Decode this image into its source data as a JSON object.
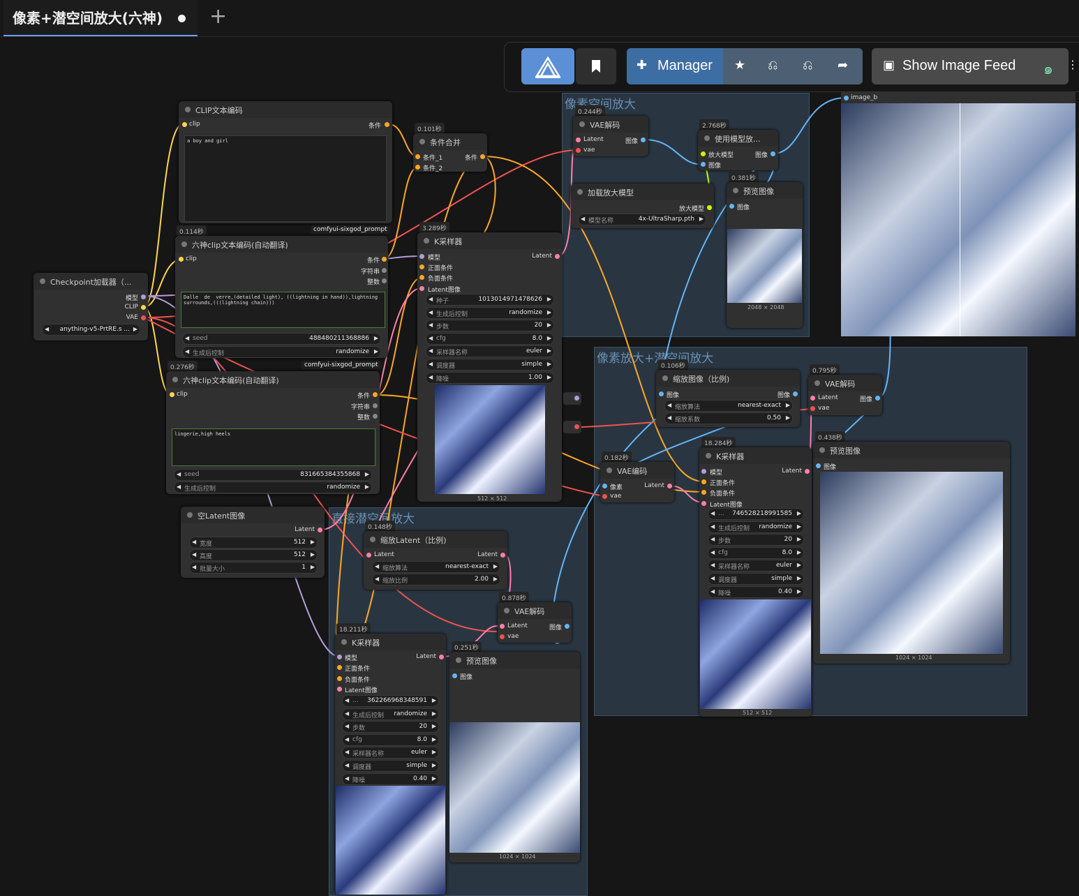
{
  "tab": {
    "title": "像素+潜空间放大(六神)"
  },
  "toolbar": {
    "manager_label": "Manager",
    "feed_label": "Show Image Feed"
  },
  "groups": {
    "pixel": "像素空间放大",
    "mixed": "像素放大+潜空间放大",
    "direct": "直接潜空间放大"
  },
  "nodes": {
    "clip_encode": {
      "title": "CLIP文本编码",
      "in_clip": "clip",
      "out": "条件",
      "text": "a boy and girl"
    },
    "cond_combine": {
      "timing": "0.101秒",
      "title": "条件合并",
      "in1": "条件_1",
      "in2": "条件_2",
      "out": "条件"
    },
    "six_pos": {
      "timing": "0.114秒",
      "tag": "comfyui-sixgod_prompt",
      "title": "六神clip文本编码(自动翻译)",
      "in_clip": "clip",
      "out1": "条件",
      "out2": "字符串",
      "out3": "整数",
      "text": "Dalle  de  verre,(detailed light), ((lightning in hand)),lightning surrounds,(((lightning chain)))",
      "seed_label": "seed",
      "seed": "488480211368886",
      "ctrl_label": "生成后控制",
      "ctrl": "randomize"
    },
    "six_neg": {
      "timing": "0.276秒",
      "tag": "comfyui-sixgod_prompt",
      "title": "六神clip文本编码(自动翻译)",
      "in_clip": "clip",
      "out1": "条件",
      "out2": "字符串",
      "out3": "整数",
      "text": "lingerie,high heels",
      "seed_label": "seed",
      "seed": "831665384355868",
      "ctrl_label": "生成后控制",
      "ctrl": "randomize"
    },
    "checkpoint": {
      "title": "Checkpoint加载器（...",
      "out1": "模型",
      "out2": "CLIP",
      "out3": "VAE",
      "model": "anything-v5-PrtRE.s ..."
    },
    "empty_latent": {
      "title": "空Latent图像",
      "out": "Latent",
      "w_label": "宽度",
      "w": "512",
      "h_label": "高度",
      "h": "512",
      "b_label": "批量大小",
      "b": "1"
    },
    "ksampler1": {
      "timing": "3.289秒",
      "title": "K采样器",
      "in1": "模型",
      "in2": "正面条件",
      "in3": "负面条件",
      "in4": "Latent图像",
      "out": "Latent",
      "rows": [
        {
          "l": "种子",
          "v": "1013014971478626"
        },
        {
          "l": "生成后控制",
          "v": "randomize"
        },
        {
          "l": "步数",
          "v": "20"
        },
        {
          "l": "cfg",
          "v": "8.0"
        },
        {
          "l": "采样器名称",
          "v": "euler"
        },
        {
          "l": "调度器",
          "v": "simple"
        },
        {
          "l": "降噪",
          "v": "1.00"
        }
      ],
      "dims": "512 × 512"
    },
    "vae_decode1": {
      "timing": "0.244秒",
      "title": "VAE解码",
      "in1": "Latent",
      "in2": "vae",
      "out": "图像"
    },
    "upscale_use": {
      "timing": "2.768秒",
      "title": "使用模型放...",
      "in1": "放大模型",
      "in2": "图像",
      "out": "图像"
    },
    "load_upscale": {
      "title": "加载放大模型",
      "out": "放大模型",
      "w_label": "模型名称",
      "w": "4x-UltraSharp.pth"
    },
    "preview1": {
      "timing": "0.381秒",
      "title": "预览图像",
      "in": "图像",
      "dims": "2048 × 2048"
    },
    "compare": {
      "in": "image_b"
    },
    "scale_image": {
      "timing": "0.106秒",
      "title": "缩放图像（比例)",
      "in": "图像",
      "out": "图像",
      "w1_label": "缩放算法",
      "w1": "nearest-exact",
      "w2_label": "缩放系数",
      "w2": "0.50"
    },
    "vae_decode2": {
      "timing": "0.795秒",
      "title": "VAE解码",
      "in1": "Latent",
      "in2": "vae",
      "out": "图像"
    },
    "preview2": {
      "timing": "0.438秒",
      "title": "预览图像",
      "in": "图像",
      "dims": "1024 × 1024"
    },
    "vae_encode": {
      "timing": "0.182秒",
      "title": "VAE编码",
      "in1": "像素",
      "in2": "vae",
      "out": "Latent"
    },
    "ksampler2": {
      "timing": "18.284秒",
      "title": "K采样器",
      "in1": "模型",
      "in2": "正面条件",
      "in3": "负面条件",
      "in4": "Latent图像",
      "out": "Latent",
      "rows": [
        {
          "l": "...",
          "v": "746528218991585"
        },
        {
          "l": "生成后控制",
          "v": "randomize"
        },
        {
          "l": "步数",
          "v": "20"
        },
        {
          "l": "cfg",
          "v": "8.0"
        },
        {
          "l": "采样器名称",
          "v": "euler"
        },
        {
          "l": "调度器",
          "v": "simple"
        },
        {
          "l": "降噪",
          "v": "0.40"
        }
      ],
      "dims": "512 × 512"
    },
    "latent_scale": {
      "timing": "0.148秒",
      "title": "缩放Latent（比例)",
      "in": "Latent",
      "out": "Latent",
      "w1_label": "缩放算法",
      "w1": "nearest-exact",
      "w2_label": "缩放比例",
      "w2": "2.00"
    },
    "vae_decode3": {
      "timing": "0.878秒",
      "title": "VAE解码",
      "in1": "Latent",
      "in2": "vae",
      "out": "图像"
    },
    "ksampler3": {
      "timing": "18.211秒",
      "title": "K采样器",
      "in1": "模型",
      "in2": "正面条件",
      "in3": "负面条件",
      "in4": "Latent图像",
      "out": "Latent",
      "rows": [
        {
          "l": "...",
          "v": "362266968348591"
        },
        {
          "l": "生成后控制",
          "v": "randomize"
        },
        {
          "l": "步数",
          "v": "20"
        },
        {
          "l": "cfg",
          "v": "8.0"
        },
        {
          "l": "采样器名称",
          "v": "euler"
        },
        {
          "l": "调度器",
          "v": "simple"
        },
        {
          "l": "降噪",
          "v": "0.40"
        }
      ]
    },
    "preview3": {
      "timing": "0.251秒",
      "title": "预览图像",
      "in": "图像",
      "dims": "1024 × 1024"
    }
  },
  "colors": {
    "model": "#b39ddb",
    "clip": "#ffd54f",
    "vae": "#ef5350",
    "cond": "#ffa726",
    "latent": "#ff80ab",
    "image": "#64b5f6",
    "upscale": "#c6ff00"
  }
}
